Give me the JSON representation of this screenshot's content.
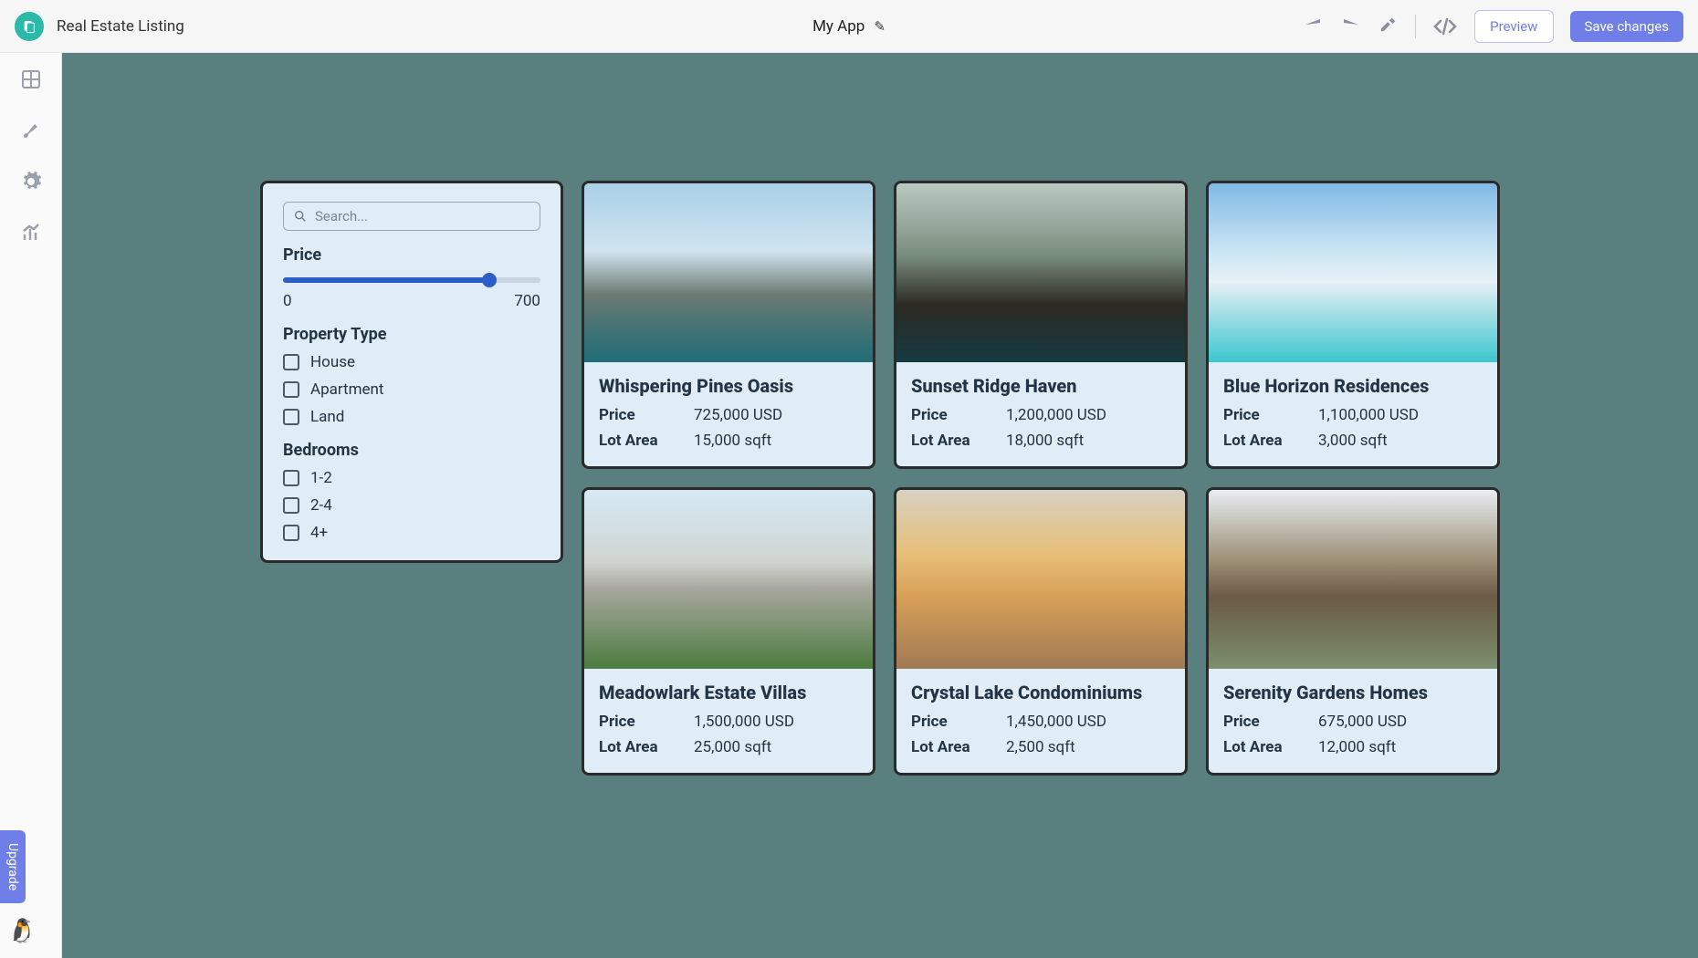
{
  "header": {
    "page_name": "Real Estate Listing",
    "app_title": "My App",
    "preview_label": "Preview",
    "save_label": "Save changes"
  },
  "sidebar": {
    "upgrade_label": "Upgrade"
  },
  "filters": {
    "search_placeholder": "Search...",
    "price_label": "Price",
    "price_min": "0",
    "price_max": "700",
    "property_type_label": "Property Type",
    "property_types": [
      "House",
      "Apartment",
      "Land"
    ],
    "bedrooms_label": "Bedrooms",
    "bedroom_options": [
      "1-2",
      "2-4",
      "4+"
    ]
  },
  "listings": [
    {
      "title": "Whispering Pines Oasis",
      "price_label": "Price",
      "price": "725,000 USD",
      "lot_label": "Lot Area",
      "lot": "15,000 sqft"
    },
    {
      "title": "Sunset Ridge Haven",
      "price_label": "Price",
      "price": "1,200,000 USD",
      "lot_label": "Lot Area",
      "lot": "18,000 sqft"
    },
    {
      "title": "Blue Horizon Residences",
      "price_label": "Price",
      "price": "1,100,000 USD",
      "lot_label": "Lot Area",
      "lot": "3,000 sqft"
    },
    {
      "title": "Meadowlark Estate Villas",
      "price_label": "Price",
      "price": "1,500,000 USD",
      "lot_label": "Lot Area",
      "lot": "25,000 sqft"
    },
    {
      "title": "Crystal Lake Condominiums",
      "price_label": "Price",
      "price": "1,450,000 USD",
      "lot_label": "Lot Area",
      "lot": "2,500 sqft"
    },
    {
      "title": "Serenity Gardens Homes",
      "price_label": "Price",
      "price": "675,000 USD",
      "lot_label": "Lot Area",
      "lot": "12,000 sqft"
    }
  ]
}
